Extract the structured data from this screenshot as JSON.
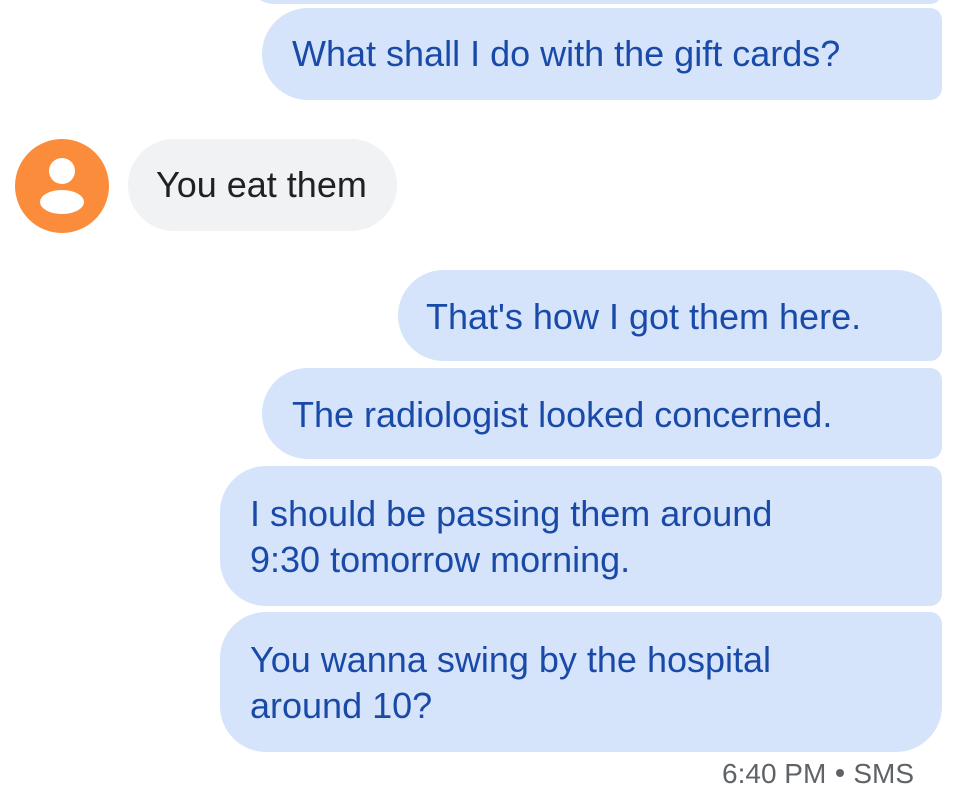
{
  "thread": {
    "messages": [
      {
        "direction": "outgoing",
        "lines": [
          "What shall I do with the gift cards?"
        ]
      },
      {
        "direction": "incoming",
        "lines": [
          "You eat them"
        ]
      },
      {
        "direction": "outgoing",
        "lines": [
          "That's how I got them here."
        ]
      },
      {
        "direction": "outgoing",
        "lines": [
          "The radiologist looked concerned."
        ]
      },
      {
        "direction": "outgoing",
        "lines": [
          "I should be passing them around",
          "9:30 tomorrow morning."
        ]
      },
      {
        "direction": "outgoing",
        "lines": [
          "You wanna swing by the hospital",
          "around 10?"
        ]
      }
    ],
    "footer": {
      "time": "6:40 PM",
      "type": "SMS"
    }
  },
  "colors": {
    "outgoing_bubble": "#d5e4fb",
    "outgoing_text": "#1a4aa8",
    "incoming_bubble": "#f1f2f4",
    "incoming_text": "#202124",
    "avatar": "#fb8c3c"
  },
  "icons": {
    "avatar": "person-icon"
  }
}
